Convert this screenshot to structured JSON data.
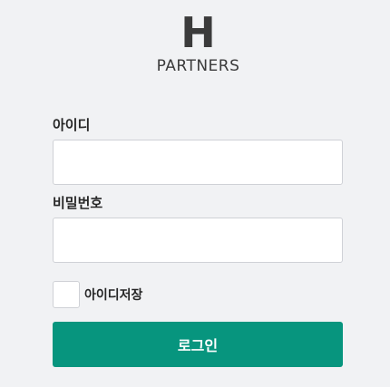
{
  "brand": {
    "mark": "H",
    "name": "PARTNERS"
  },
  "form": {
    "id_label": "아이디",
    "id_value": "",
    "password_label": "비밀번호",
    "password_value": "",
    "remember_label": "아이디저장",
    "remember_checked": false,
    "login_label": "로그인"
  },
  "colors": {
    "background": "#f1f2f4",
    "accent": "#07957e",
    "text": "#262626"
  }
}
